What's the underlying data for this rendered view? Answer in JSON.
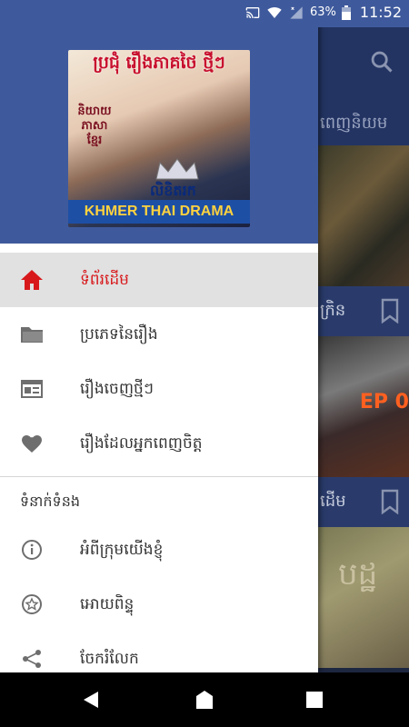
{
  "status": {
    "battery": "63%",
    "time": "11:52"
  },
  "drawer": {
    "header": {
      "poster_title": "ប្រជុំ រឿងភាគថៃ ថ្មីៗ",
      "poster_side_text": "និយាយ ភាសា ខ្មែរ",
      "poster_script": "លិខិតរក",
      "poster_banner": "KHMER THAI DRAMA"
    },
    "items": [
      {
        "label": "ទំព័រដើម",
        "icon": "home-icon",
        "active": true
      },
      {
        "label": "ប្រភេទនៃរឿង",
        "icon": "folder-icon"
      },
      {
        "label": "រឿងចេញថ្មីៗ",
        "icon": "news-icon"
      },
      {
        "label": "រឿងដែលអ្នកពេញចិត្ត",
        "icon": "heart-icon"
      }
    ],
    "section_title": "ទំនាក់ទំនង",
    "contact_items": [
      {
        "label": "អំពីក្រុមយើងខ្ញុំ",
        "icon": "info-icon"
      },
      {
        "label": "អោយពិន្ទុ",
        "icon": "star-icon"
      },
      {
        "label": "ចែករំលែក",
        "icon": "share-icon"
      }
    ]
  },
  "background": {
    "tab_label": "ពេញនិយម",
    "card_titles": [
      "ក្រិន",
      "ដើម"
    ],
    "card2_badge": "EP 0",
    "card3_text": "បដ្ឋ"
  },
  "colors": {
    "primary": "#3f5a9c",
    "active_red": "#d8191c",
    "active_bg": "#e1e1e1"
  }
}
